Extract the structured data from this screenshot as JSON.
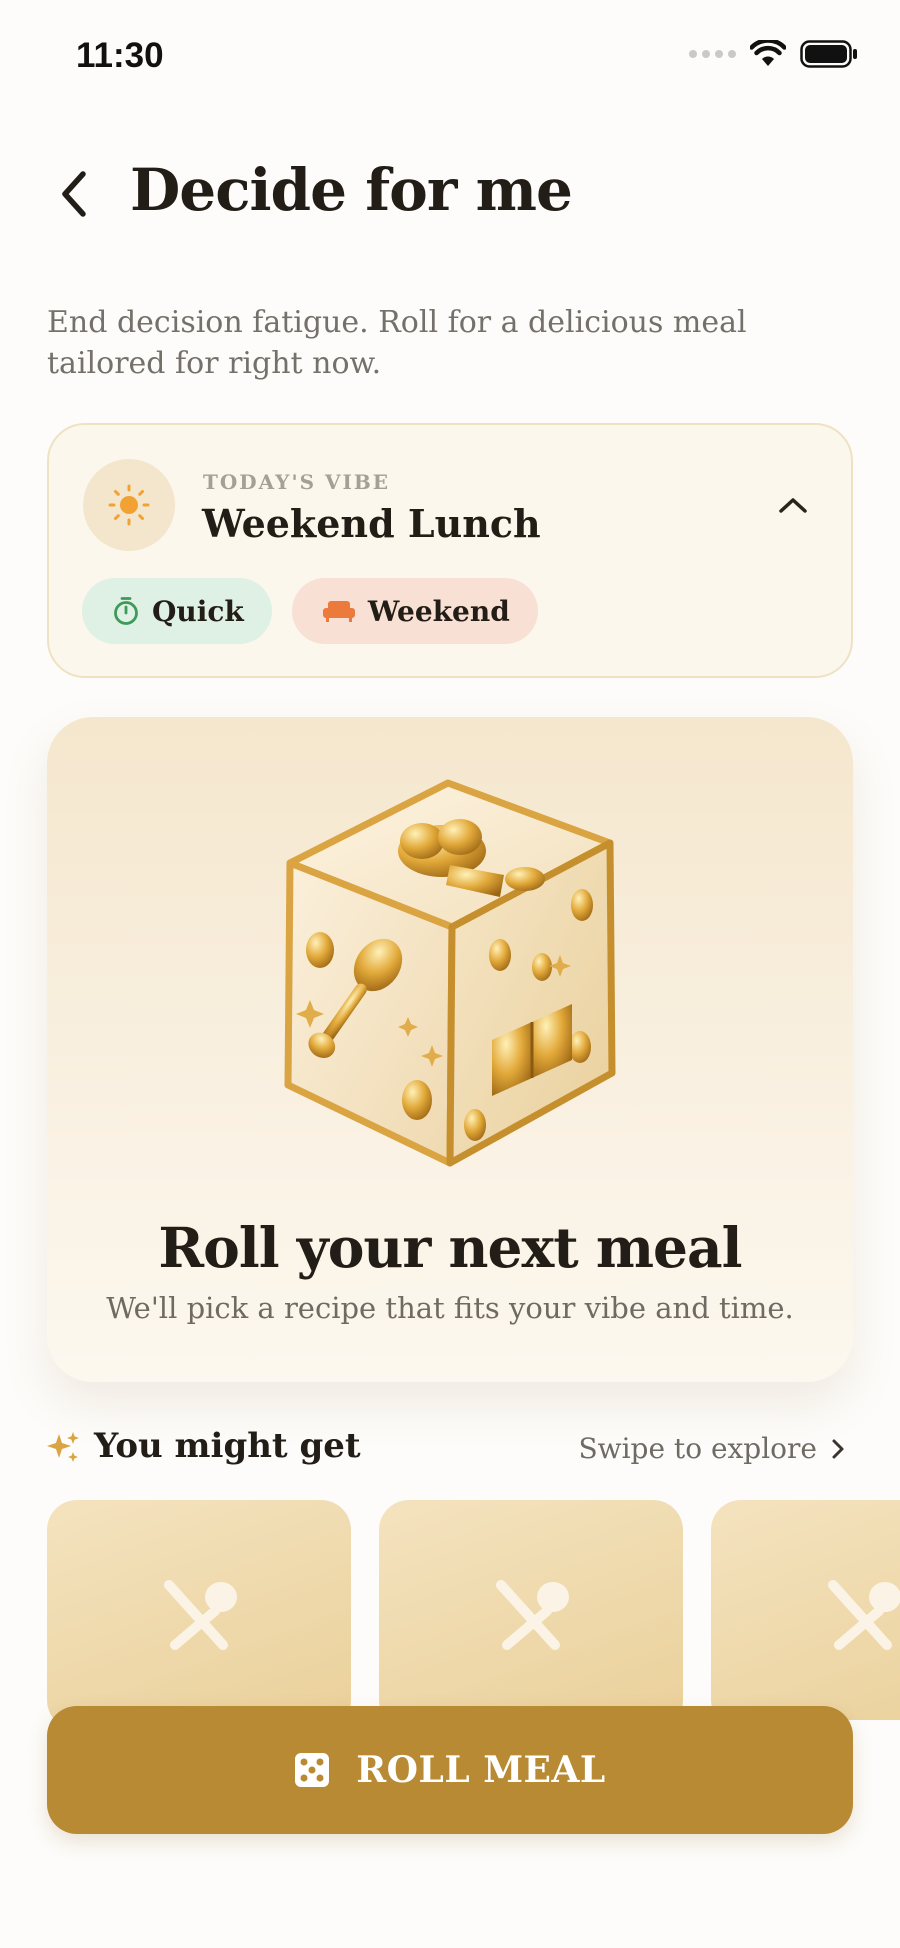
{
  "status_bar": {
    "time": "11:30"
  },
  "header": {
    "title": "Decide for me"
  },
  "intro": {
    "text": "End decision fatigue. Roll for a delicious meal tailored for right now."
  },
  "vibe": {
    "eyebrow": "TODAY'S VIBE",
    "title": "Weekend Lunch",
    "chips": [
      {
        "label": "Quick",
        "icon": "timer-icon",
        "color": "#dff0e4"
      },
      {
        "label": "Weekend",
        "icon": "couch-icon",
        "color": "#f9e0d4"
      }
    ]
  },
  "hero": {
    "title": "Roll your next meal",
    "subtitle": "We'll pick a recipe that fits your vibe and time."
  },
  "suggestions": {
    "title": "You might get",
    "swipe_label": "Swipe to explore",
    "cards": [
      {
        "icon": "utensils-icon"
      },
      {
        "icon": "utensils-icon"
      },
      {
        "icon": "utensils-icon"
      }
    ]
  },
  "roll_button": {
    "label": "ROLL MEAL",
    "icon": "dice-icon"
  },
  "colors": {
    "accent": "#b88a33",
    "background": "#fdfcfa",
    "vibe_card": "#fbf7ed"
  }
}
